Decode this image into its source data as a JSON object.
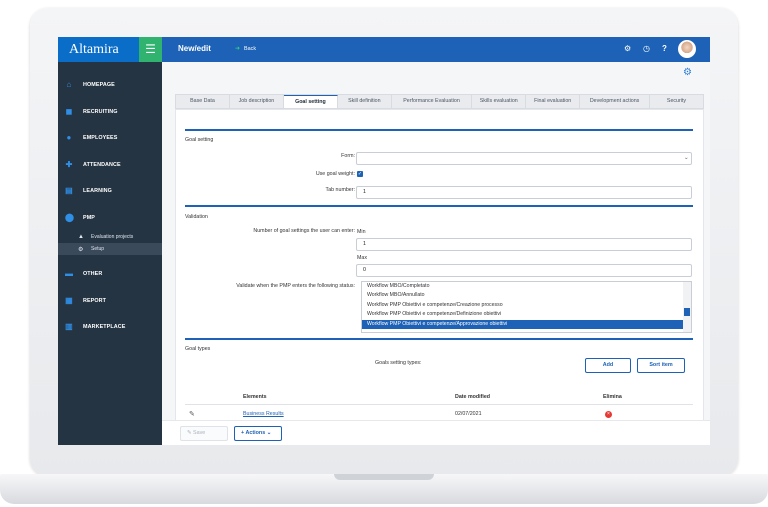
{
  "app": {
    "logo": "Altamira",
    "page_title": "New/edit",
    "back_label": "Back"
  },
  "sidebar": {
    "items": [
      {
        "label": "HOMEPAGE",
        "icon": "home-icon"
      },
      {
        "label": "RECRUITING",
        "icon": "users-icon"
      },
      {
        "label": "EMPLOYEES",
        "icon": "people-icon"
      },
      {
        "label": "ATTENDANCE",
        "icon": "attendance-icon"
      },
      {
        "label": "LEARNING",
        "icon": "learning-icon"
      },
      {
        "label": "PMP",
        "icon": "pmp-icon"
      }
    ],
    "pmp_sub": [
      {
        "label": "Evaluation projects",
        "icon": "rocket-icon"
      },
      {
        "label": "Setup",
        "icon": "setup-icon"
      }
    ],
    "items_after": [
      {
        "label": "OTHER",
        "icon": "other-icon"
      },
      {
        "label": "REPORT",
        "icon": "report-icon"
      },
      {
        "label": "MARKETPLACE",
        "icon": "marketplace-icon"
      }
    ]
  },
  "tabs": [
    "Base Data",
    "Job description",
    "Goal setting",
    "Skill definition",
    "Performance Evaluation",
    "Skills evaluation",
    "Final evaluation",
    "Development actions",
    "Security"
  ],
  "active_tab": "Goal setting",
  "goal_setting": {
    "section_title": "Goal setting",
    "form_label": "Form:",
    "form_value": "",
    "use_goal_weight_label": "Use goal weight:",
    "use_goal_weight_checked": true,
    "tab_number_label": "Tab number:",
    "tab_number_value": "1"
  },
  "validation": {
    "section_title": "Validation",
    "num_goals_label": "Number of goal settings the user can enter:",
    "min_label": "Min",
    "min_value": "1",
    "max_label": "Max",
    "max_value": "0",
    "status_label": "Validate when the PMP enters the following status:",
    "status_options": [
      "Workflow MBO/Completato",
      "Workflow MBO/Annullato",
      "Workflow PMP Obiettivi e competenze/Creazione processo",
      "Workflow PMP Obiettivi e competenze/Definizione obiettivi",
      "Workflow PMP Obiettivi e competenze/Approvazione obiettivi"
    ],
    "selected_index": 4
  },
  "goal_types": {
    "section_title": "Goal types",
    "settings_label": "Goals setting types:",
    "add_label": "Add",
    "sort_label": "Sort item",
    "columns": [
      "Elements",
      "Date modified",
      "Elimina"
    ],
    "rows": [
      {
        "element": "Business Results",
        "date": "02/07/2021"
      }
    ]
  },
  "footer": {
    "save_label": "Save",
    "actions_label": "Actions"
  },
  "colors": {
    "primary": "#1d62b6",
    "sidebar": "#253443",
    "green": "#2fb36f",
    "delete": "#e53935"
  }
}
